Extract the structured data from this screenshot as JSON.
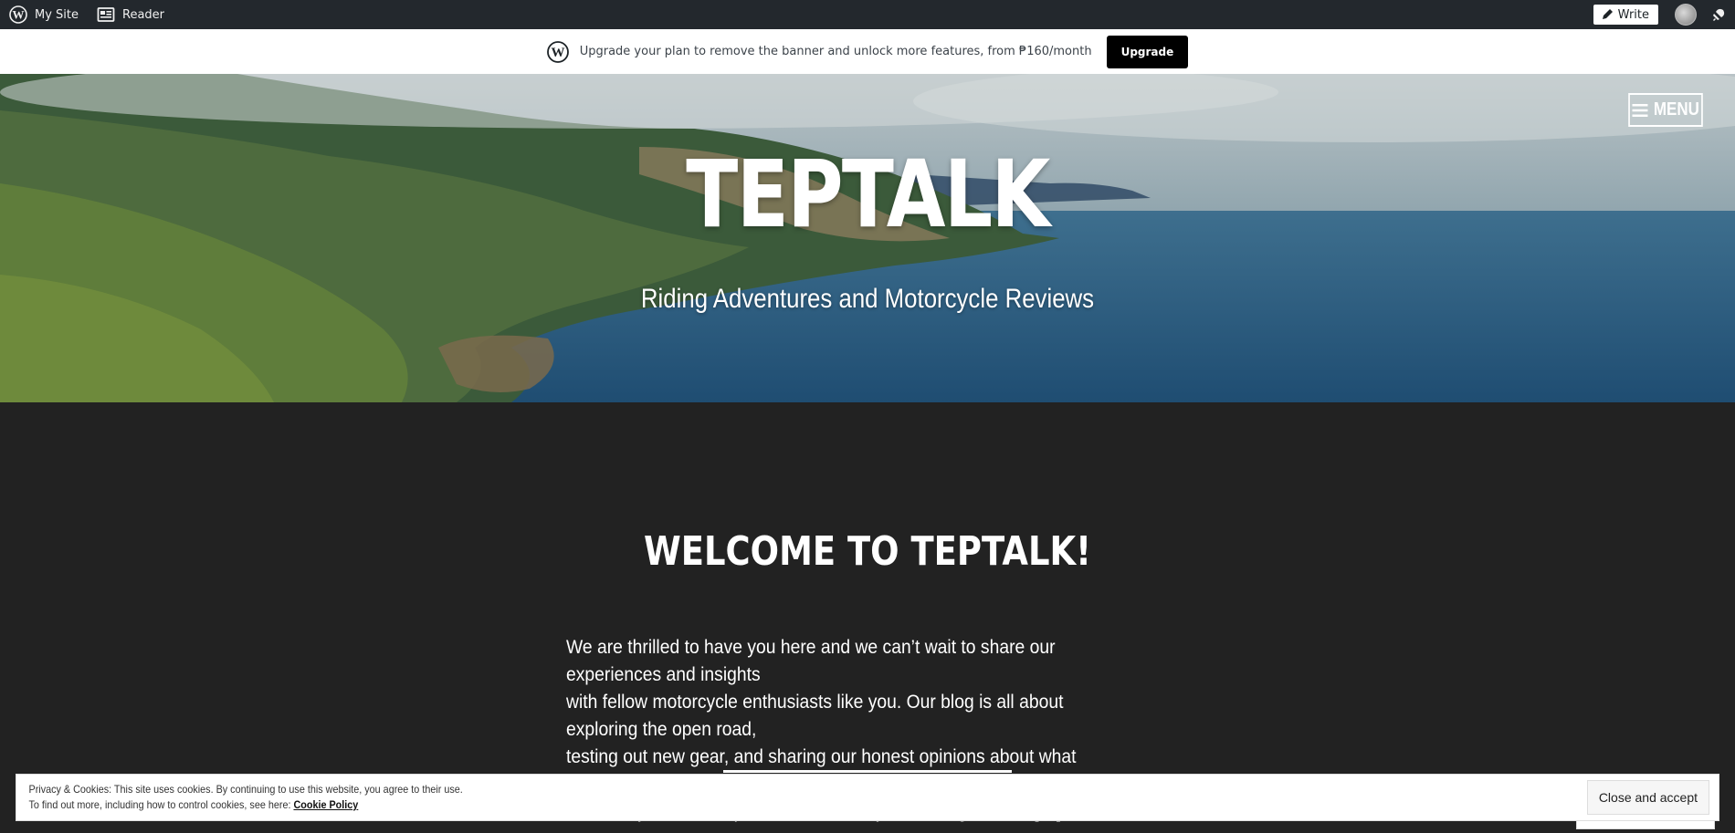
{
  "adminbar": {
    "my_site": "My Site",
    "reader": "Reader",
    "write": "Write",
    "icons": [
      "wordpress-icon",
      "reader-icon",
      "pen-icon",
      "avatar",
      "bell-icon"
    ]
  },
  "banner": {
    "text": "Upgrade your plan to remove the banner and unlock more features, from ₱160/month",
    "button": "Upgrade"
  },
  "hero": {
    "menu": "MENU",
    "site_title": "TEPTALK",
    "tagline": "Riding Adventures and Motorcycle Reviews"
  },
  "post": {
    "title": "WELCOME TO TEPTALK!",
    "excerpt_lines": [
      "We are thrilled to have you here and we can’t wait to share our experiences and insights",
      "with fellow motorcycle enthusiasts like you. Our blog is all about exploring the open road,",
      "testing out new gear, and sharing our honest opinions about what we’ve discovered.",
      "Whether you’re an experienced rider or just starting out, we […]"
    ]
  },
  "cookie": {
    "line1": "Privacy & Cookies: This site uses cookies. By continuing to use this website, you agree to their use.",
    "line2_prefix": "To find out more, including how to control cookies, see here: ",
    "link": "Cookie Policy",
    "accept": "Close and accept"
  },
  "colors": {
    "adminbar": "#23282d",
    "content_bg": "#222222",
    "banner_button": "#000000"
  }
}
